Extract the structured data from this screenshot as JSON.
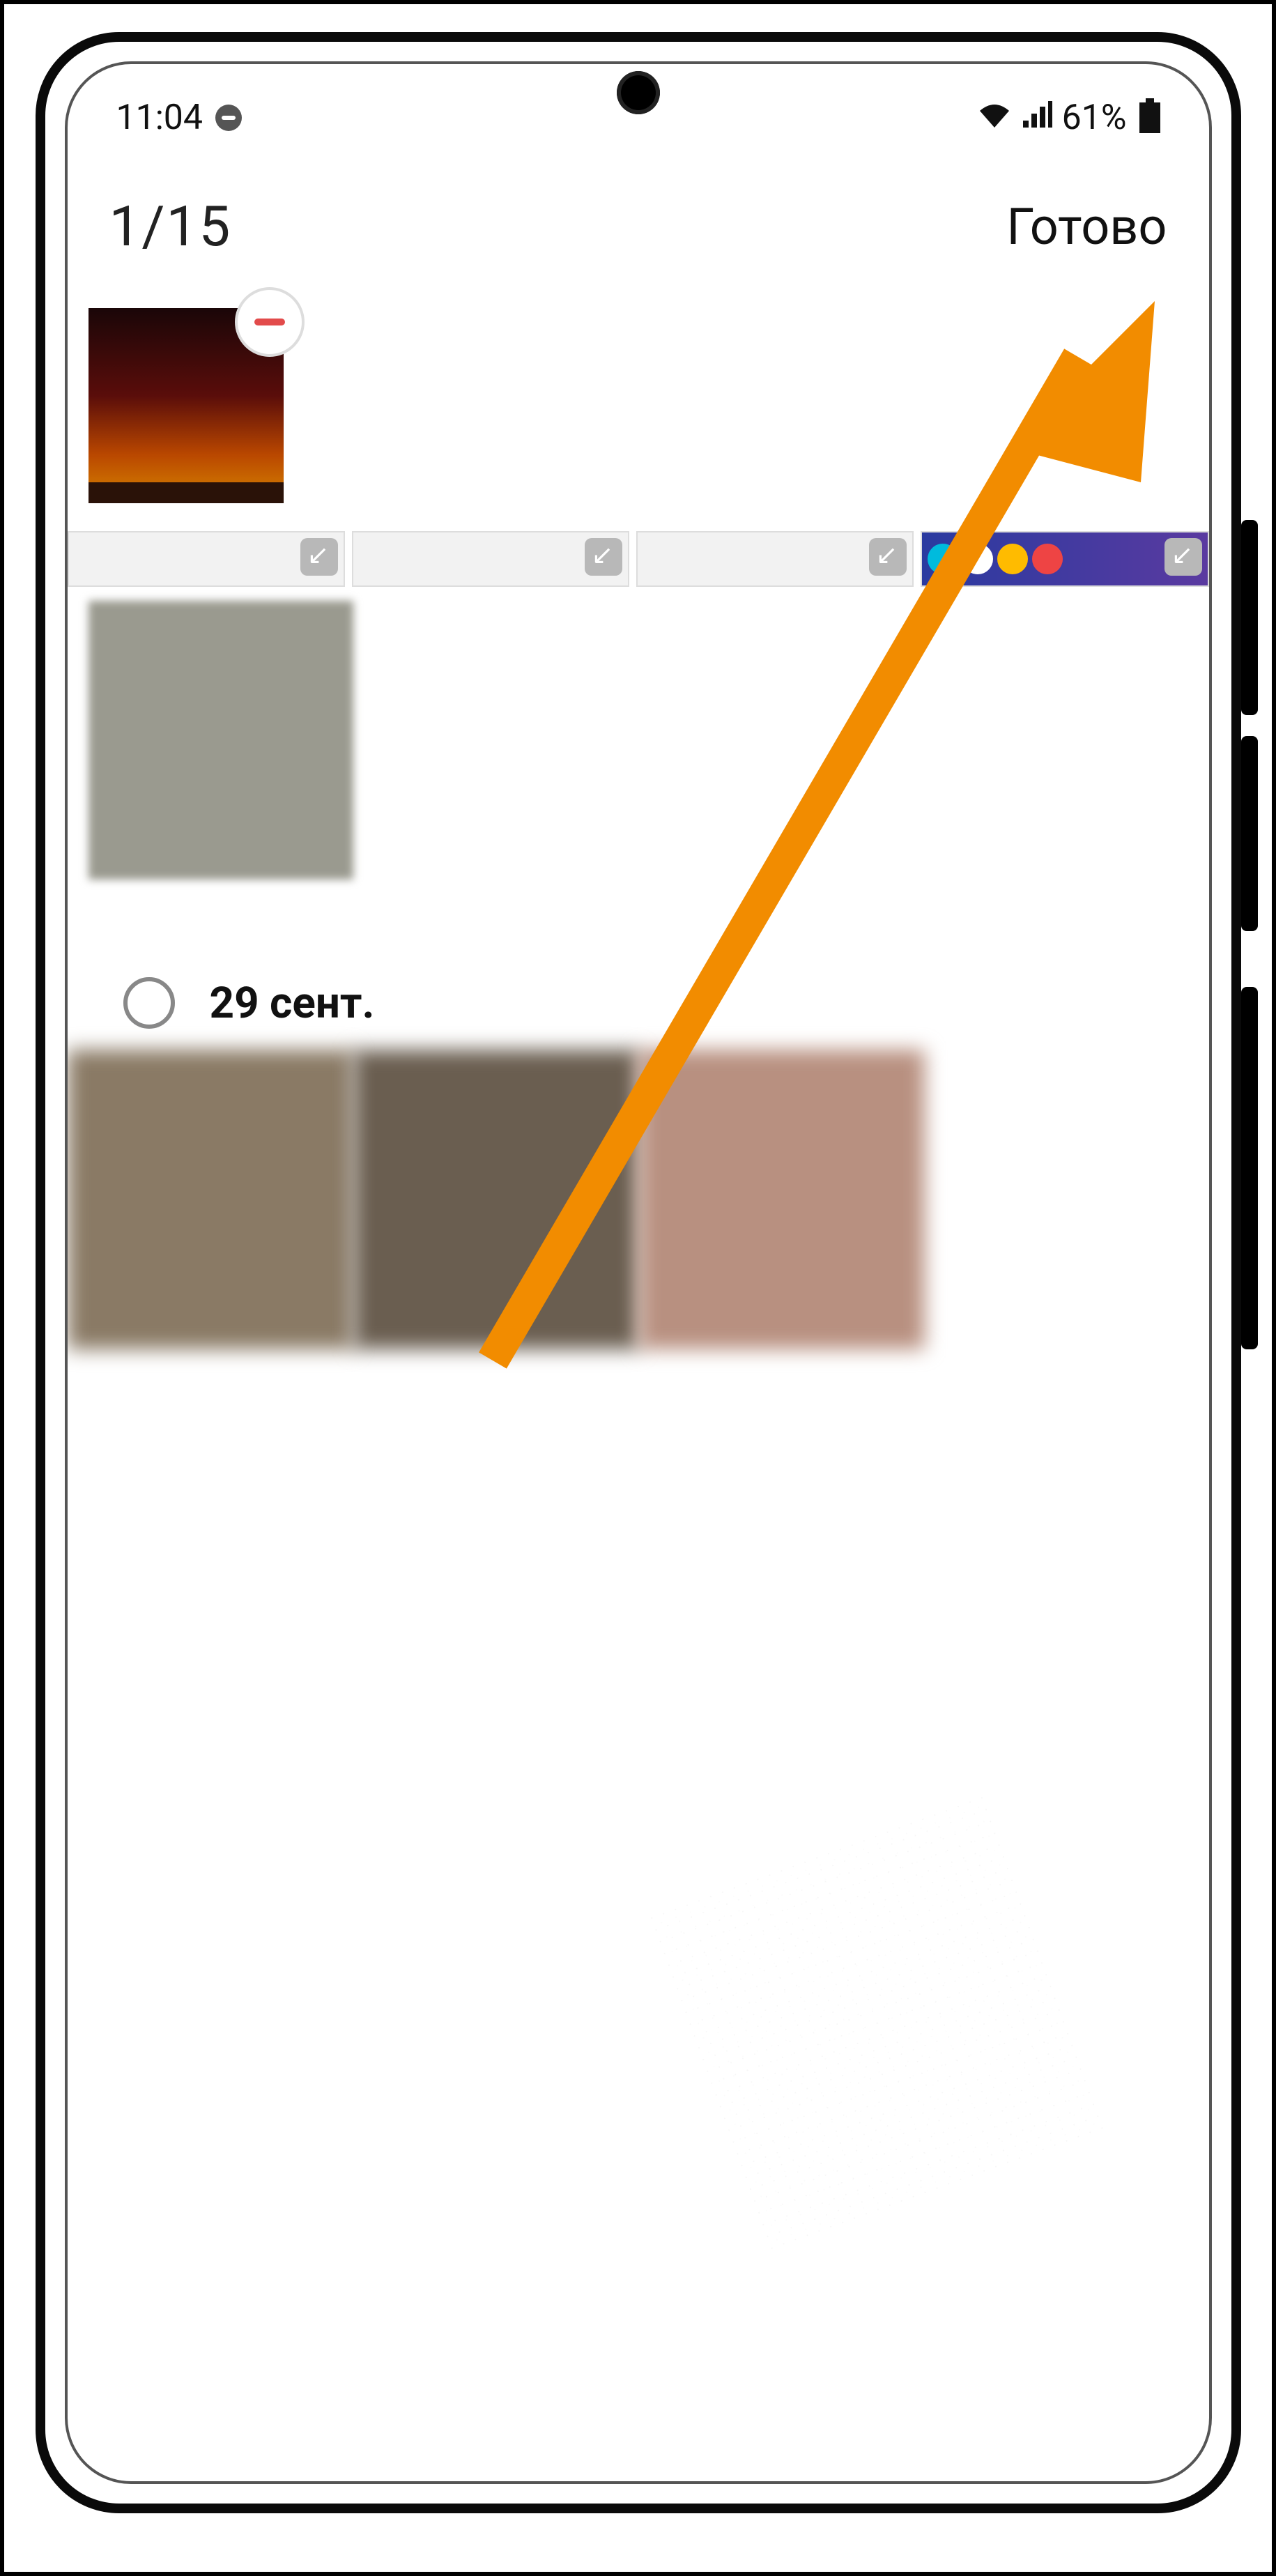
{
  "status": {
    "time": "11:04",
    "battery_text": "61%"
  },
  "toolbar": {
    "counter": "1/15",
    "done_label": "Готово"
  },
  "date_group": {
    "label": "29 сент."
  }
}
